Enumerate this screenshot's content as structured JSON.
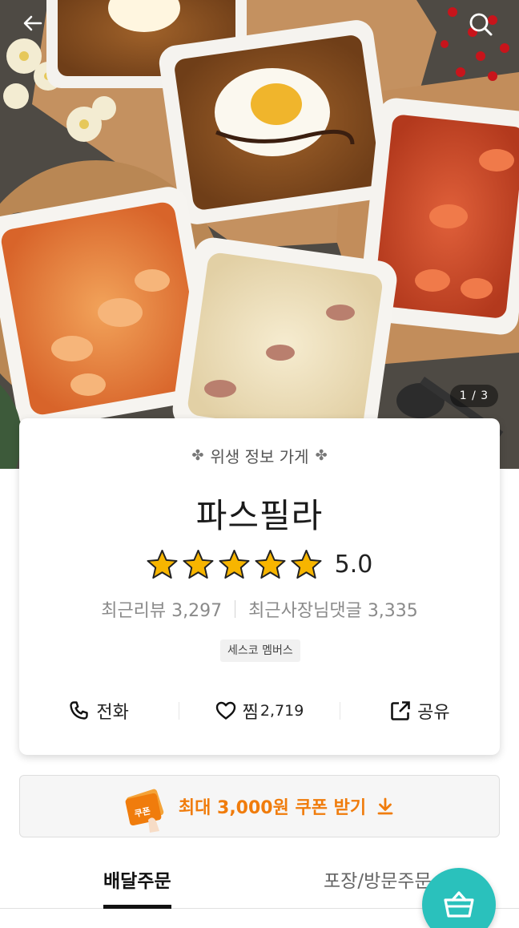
{
  "hero": {
    "image_counter": "1 / 3",
    "back_icon": "arrow-left-icon",
    "search_icon": "search-icon"
  },
  "store": {
    "hygiene_label": "위생 정보 가게",
    "name": "파스필라",
    "rating": "5.0",
    "rating_stars": 5,
    "recent_reviews": "최근리뷰 3,297",
    "owner_replies": "최근사장님댓글 3,335",
    "badge": "세스코 멤버스"
  },
  "actions": {
    "call_label": "전화",
    "like_label": "찜",
    "like_count": "2,719",
    "share_label": "공유"
  },
  "coupon": {
    "label": "최대 3,000원 쿠폰 받기",
    "ticket_text": "쿠폰"
  },
  "tabs": [
    {
      "label": "배달주문",
      "active": true
    },
    {
      "label": "포장/방문주문",
      "active": false
    }
  ],
  "colors": {
    "accent_orange": "#f07c0c",
    "mint": "#2ac1bc",
    "star": "#f7b500"
  }
}
